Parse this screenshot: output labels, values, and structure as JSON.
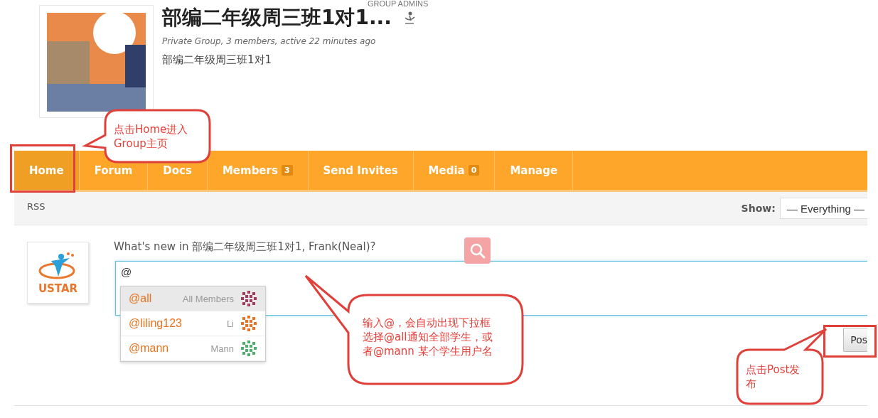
{
  "group": {
    "admins_label": "GROUP ADMINS",
    "title": "部编二年级周三班1对1...",
    "meta": "Private Group, 3 members, active 22 minutes ago",
    "description": "部编二年级周三班1对1"
  },
  "nav": {
    "tabs": [
      {
        "label": "Home",
        "selected": true
      },
      {
        "label": "Forum",
        "selected": false
      },
      {
        "label": "Docs",
        "selected": false
      },
      {
        "label": "Members",
        "count": "3",
        "selected": false
      },
      {
        "label": "Send Invites",
        "selected": false
      },
      {
        "label": "Media",
        "count": "0",
        "selected": false
      },
      {
        "label": "Manage",
        "selected": false
      }
    ]
  },
  "subnav": {
    "rss": "RSS",
    "show_label": "Show:",
    "show_value": "— Everything —"
  },
  "post_form": {
    "avatar_label": "USTAR",
    "prompt": "What's new in 部编二年级周三班1对1, Frank(Neal)?",
    "value": "@",
    "mentions": [
      {
        "handle": "@all",
        "name": "All Members",
        "color": "#a33a5c",
        "selected": true
      },
      {
        "handle": "@liling123",
        "name": "Li",
        "color": "#f07020",
        "selected": false
      },
      {
        "handle": "@mann",
        "name": "Mann",
        "color": "#4caf6a",
        "selected": false
      }
    ],
    "post_button": "Pos"
  },
  "annotations": [
    {
      "lines": [
        "点击Home进入",
        "Group主页"
      ]
    },
    {
      "lines": [
        "输入@，会自动出现下拉框",
        "选择@all通知全部学生，或",
        "者@mann 某个学生用户名"
      ]
    },
    {
      "lines": [
        "点击Post发",
        "布"
      ]
    }
  ]
}
